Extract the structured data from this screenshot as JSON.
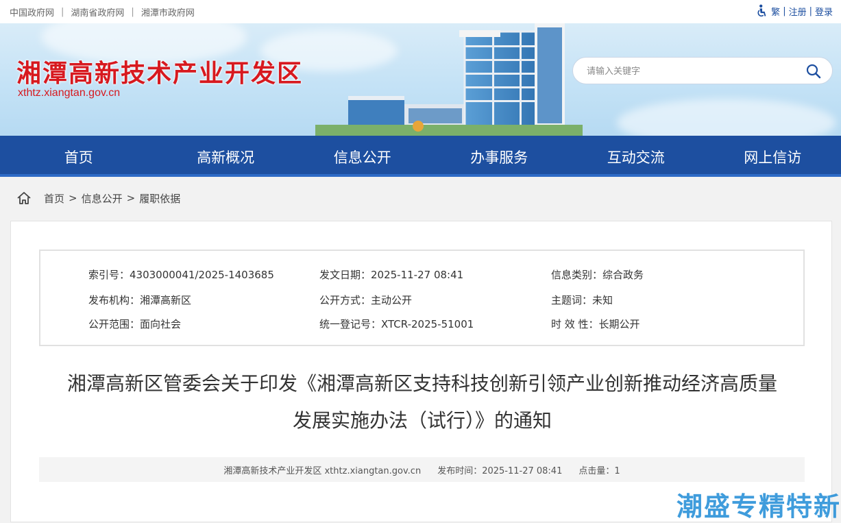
{
  "topbar": {
    "gov_links": [
      "中国政府网",
      "湖南省政府网",
      "湘潭市政府网"
    ],
    "separator": "|",
    "traditional": "繁",
    "register": "注册",
    "login": "登录"
  },
  "header": {
    "site_title": "湘潭高新技术产业开发区",
    "site_domain": "xthtz.xiangtan.gov.cn",
    "search_placeholder": "请输入关键字"
  },
  "nav": {
    "items": [
      "首页",
      "高新概况",
      "信息公开",
      "办事服务",
      "互动交流",
      "网上信访"
    ]
  },
  "breadcrumb": {
    "items": [
      "首页",
      "信息公开",
      "履职依据"
    ],
    "separator": ">"
  },
  "meta": {
    "index_no": "索引号：4303000041/2025-1403685",
    "publish_date": "发文日期：2025-11-27 08:41",
    "info_category": "信息类别：综合政务",
    "publisher": "发布机构：湘潭高新区",
    "open_mode": "公开方式：主动公开",
    "subject": "主题词：未知",
    "open_scope": "公开范围：面向社会",
    "register_no": "统一登记号：XTCR-2025-51001",
    "validity": "时 效 性：长期公开"
  },
  "document": {
    "title_line1": "湘潭高新区管委会关于印发《湘潭高新区支持科技创新引领产业创新推动经济高质量",
    "title_line2": "发展实施办法（试行）》的通知",
    "source": "湘潭高新技术产业开发区 xthtz.xiangtan.gov.cn",
    "publish_time": "发布时间：2025-11-27 08:41",
    "hits": "点击量：1"
  },
  "watermark": "潮盛专精特新",
  "colors": {
    "brand_red": "#d7191f",
    "nav_blue": "#1d4fa0",
    "link_blue": "#1d4fa0"
  },
  "icons": [
    "accessibility-icon",
    "search-icon",
    "home-icon"
  ]
}
